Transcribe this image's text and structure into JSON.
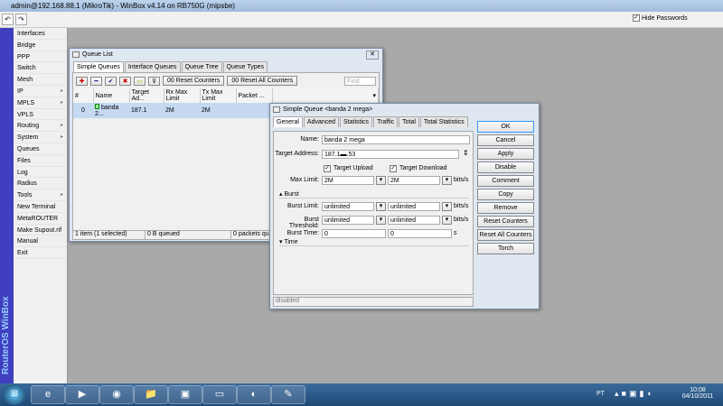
{
  "window": {
    "title": "admin@192.168.88.1 (MikroTik) - WinBox v4.14 on RB750G (mipsbe)"
  },
  "toolbar": {
    "undo": "↶",
    "redo": "↷",
    "hide_passwords": "Hide Passwords",
    "hide_checked": "✓"
  },
  "brand": "RouterOS WinBox",
  "menu": [
    {
      "label": "Interfaces"
    },
    {
      "label": "Bridge"
    },
    {
      "label": "PPP"
    },
    {
      "label": "Switch"
    },
    {
      "label": "Mesh"
    },
    {
      "label": "IP",
      "sub": "▸"
    },
    {
      "label": "MPLS",
      "sub": "▸"
    },
    {
      "label": "VPLS"
    },
    {
      "label": "Routing",
      "sub": "▸"
    },
    {
      "label": "System",
      "sub": "▸"
    },
    {
      "label": "Queues"
    },
    {
      "label": "Files"
    },
    {
      "label": "Log"
    },
    {
      "label": "Radius"
    },
    {
      "label": "Tools",
      "sub": "▸"
    },
    {
      "label": "New Terminal"
    },
    {
      "label": "MetaROUTER"
    },
    {
      "label": "Make Supout.rif"
    },
    {
      "label": "Manual"
    },
    {
      "label": "Exit"
    }
  ],
  "queue_list": {
    "title": "Queue List",
    "close": "✕",
    "tabs": [
      "Simple Queues",
      "Interface Queues",
      "Queue Tree",
      "Queue Types"
    ],
    "buttons": {
      "add": "✚",
      "remove": "━",
      "enable": "✔",
      "disable": "✖",
      "comment": "▭",
      "filter": "⊽",
      "reset": "00 Reset Counters",
      "reset_all": "00 Reset All Counters"
    },
    "find_placeholder": "Find",
    "columns": [
      "#",
      "Name",
      "Target Ad...",
      "Rx Max Limit",
      "Tx Max Limit",
      "Packet ..."
    ],
    "rows": [
      {
        "num": "0",
        "name": "banda 2...",
        "target": "187.1",
        "rx": "2M",
        "tx": "2M",
        "packet": ""
      }
    ],
    "status": [
      "1 item (1 selected)",
      "0 B queued",
      "0 packets que"
    ]
  },
  "simple_queue": {
    "title": "Simple Queue <banda 2 mega>",
    "tabs": [
      "General",
      "Advanced",
      "Statistics",
      "Traffic",
      "Total",
      "Total Statistics"
    ],
    "name_label": "Name:",
    "name": "banda 2 mega",
    "target_label": "Target Address:",
    "target": "187.1▬.53",
    "target_upload": "Target Upload",
    "target_download": "Target Download",
    "max_limit_label": "Max Limit:",
    "max_up": "2M",
    "max_down": "2M",
    "burst_section": "Burst",
    "burst_limit_label": "Burst Limit:",
    "burst_limit_up": "unlimited",
    "burst_limit_down": "unlimited",
    "burst_threshold_label": "Burst Threshold:",
    "burst_threshold_up": "unlimited",
    "burst_threshold_down": "unlimited",
    "burst_time_label": "Burst Time:",
    "burst_time_up": "0",
    "burst_time_down": "0",
    "unit_bits": "bits/s",
    "unit_s": "s",
    "time_section": "Time",
    "status": "disabled",
    "buttons": [
      "OK",
      "Cancel",
      "Apply",
      "Disable",
      "Comment",
      "Copy",
      "Remove",
      "Reset Counters",
      "Reset All Counters",
      "Torch"
    ]
  },
  "taskbar": {
    "start": "⊞",
    "apps": [
      "e",
      "▶",
      "◉",
      "📁",
      "▣",
      "▭",
      "◐",
      "✎"
    ],
    "lang": "PT",
    "time": "10:08",
    "date": "04/10/2011"
  }
}
